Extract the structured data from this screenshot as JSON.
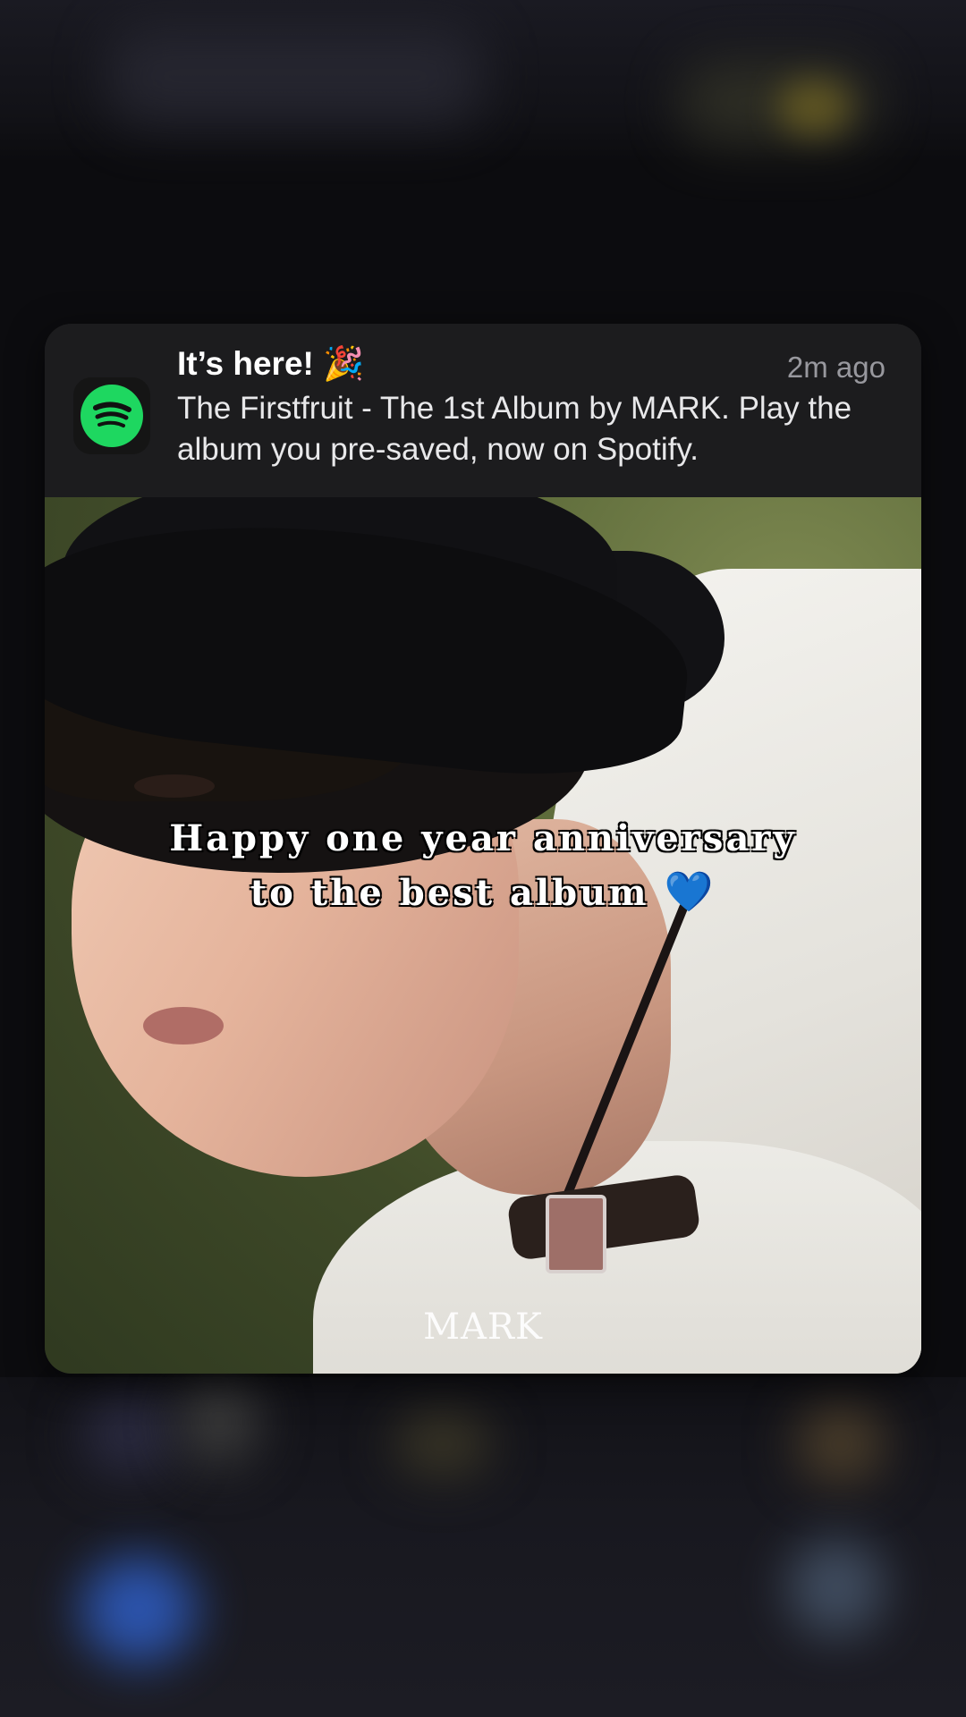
{
  "notification": {
    "app_icon": "spotify-icon",
    "title": "It’s here! 🎉",
    "time": "2m ago",
    "body": "The Firstfruit - The 1st Album by MARK. Play the album you pre-saved, now on Spotify."
  },
  "album_art": {
    "watermark": "MARK"
  },
  "caption": {
    "line1": "Happy one year anniversary",
    "line2": "to the best album",
    "emoji": "💙"
  },
  "colors": {
    "spotify_green": "#1ed760",
    "card_bg": "#1c1c1e",
    "heart": "#2f7de1"
  }
}
